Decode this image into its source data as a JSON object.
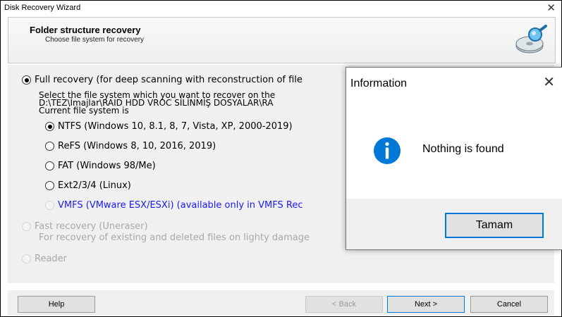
{
  "window": {
    "title": "Disk Recovery Wizard",
    "close_glyph": "✕"
  },
  "header": {
    "title": "Folder structure recovery",
    "subtitle": "Choose file system for recovery",
    "icon": "disk-magnifier-icon"
  },
  "options": {
    "full": {
      "label": "Full recovery (for deep scanning with reconstruction of file",
      "checked": true,
      "line1": "Select the file system which you want to recover on the",
      "line2": "D:\\TEZ\\İmajlar\\RAID HDD VROC SİLİNMİŞ DOSYALAR\\RA",
      "line3": "Current file system is"
    },
    "filesystems": [
      {
        "label": "NTFS (Windows 10, 8.1, 8, 7, Vista, XP, 2000-2019)",
        "checked": true
      },
      {
        "label": "ReFS (Windows 8, 10, 2016, 2019)",
        "checked": false
      },
      {
        "label": "FAT (Windows 98/Me)",
        "checked": false
      },
      {
        "label": "Ext2/3/4 (Linux)",
        "checked": false
      },
      {
        "label": "VMFS (VMware ESX/ESXi) (available only in VMFS Rec",
        "checked": false,
        "disabled": true
      }
    ],
    "fast": {
      "label": "Fast recovery (Uneraser)",
      "description": "For recovery of existing and deleted files on lighty damage",
      "disabled": true
    },
    "reader": {
      "label": "Reader",
      "disabled": true
    }
  },
  "footer": {
    "help": "Help",
    "back": "< Back",
    "next": "Next >",
    "cancel": "Cancel"
  },
  "dialog": {
    "title": "Information",
    "close_glyph": "✕",
    "message": "Nothing is found",
    "ok": "Tamam",
    "icon": "info-icon",
    "icon_color": "#0078d7"
  }
}
